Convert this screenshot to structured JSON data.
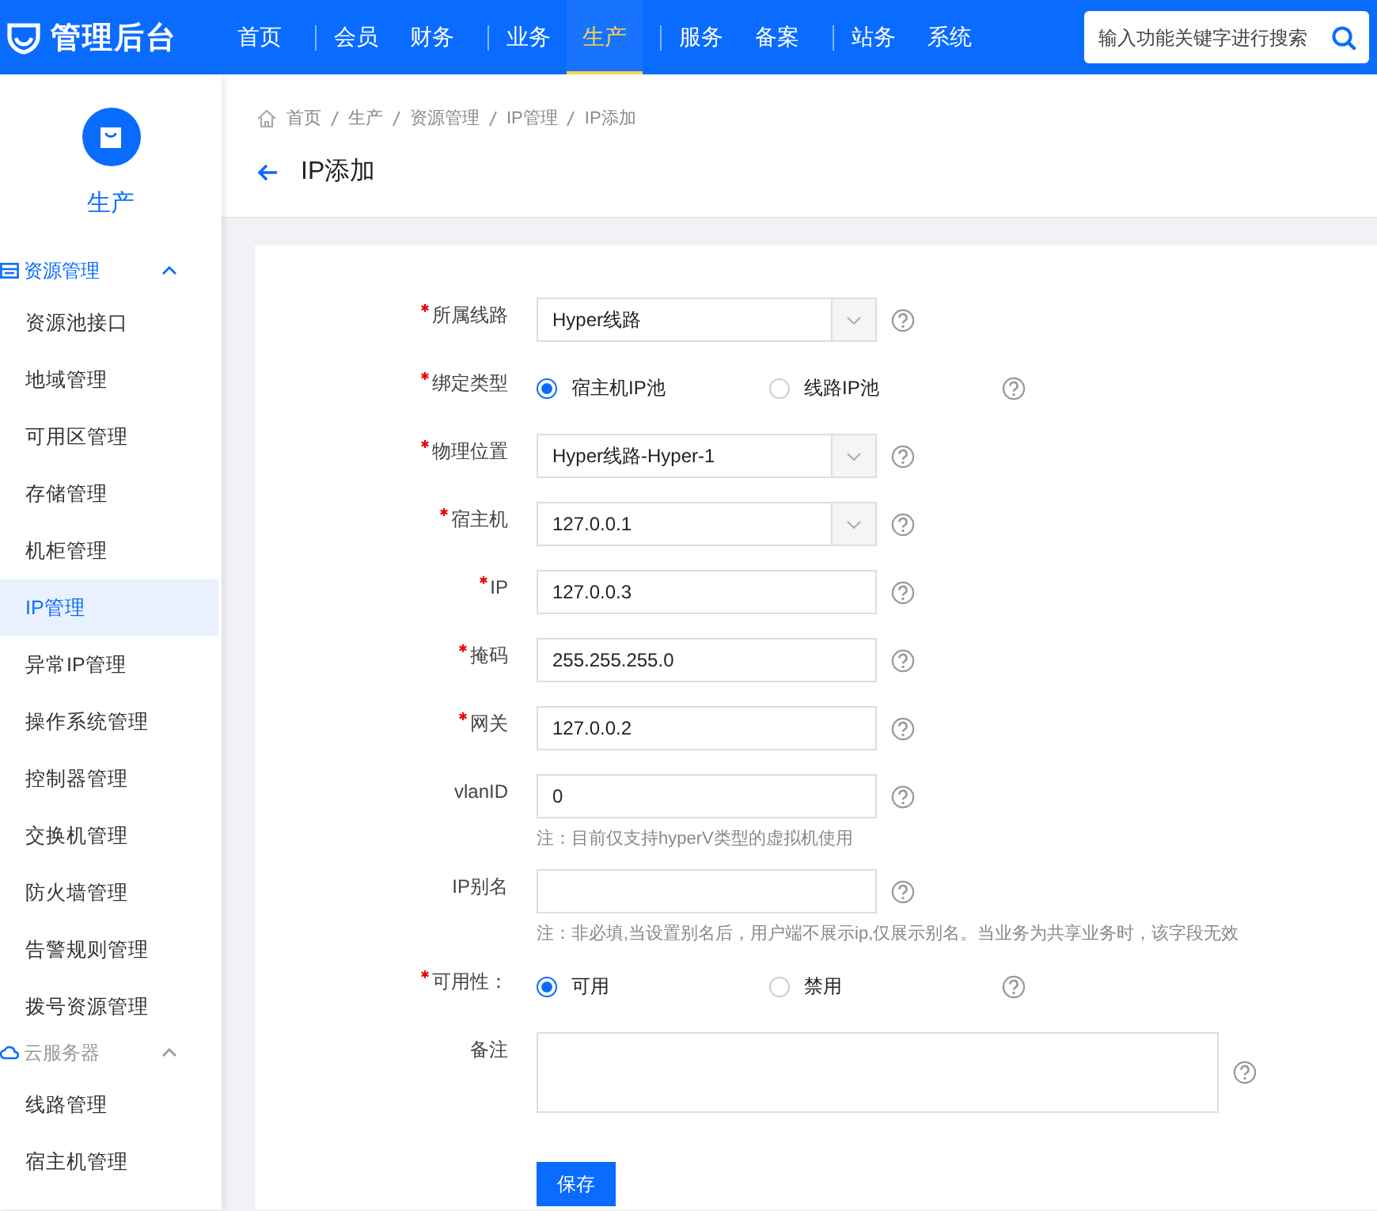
{
  "topbar": {
    "logo": "管理后台",
    "nav_groups": [
      [
        {
          "label": "首页",
          "selected": false
        }
      ],
      [
        {
          "label": "会员",
          "selected": false
        },
        {
          "label": "财务",
          "selected": false
        }
      ],
      [
        {
          "label": "业务",
          "selected": false
        },
        {
          "label": "生产",
          "selected": true
        }
      ],
      [
        {
          "label": "服务",
          "selected": false
        },
        {
          "label": "备案",
          "selected": false
        }
      ],
      [
        {
          "label": "站务",
          "selected": false
        },
        {
          "label": "系统",
          "selected": false
        }
      ]
    ],
    "search": {
      "placeholder": "输入功能关键字进行搜索"
    }
  },
  "sidebar": {
    "title": "生产",
    "groups": [
      {
        "label": "资源管理",
        "kind": "resource",
        "expanded": true,
        "items": [
          {
            "label": "资源池接口",
            "selected": false
          },
          {
            "label": "地域管理",
            "selected": false
          },
          {
            "label": "可用区管理",
            "selected": false
          },
          {
            "label": "存储管理",
            "selected": false
          },
          {
            "label": "机柜管理",
            "selected": false
          },
          {
            "label": "IP管理",
            "selected": true
          },
          {
            "label": "异常IP管理",
            "selected": false
          },
          {
            "label": "操作系统管理",
            "selected": false
          },
          {
            "label": "控制器管理",
            "selected": false
          },
          {
            "label": "交换机管理",
            "selected": false
          },
          {
            "label": "防火墙管理",
            "selected": false
          },
          {
            "label": "告警规则管理",
            "selected": false
          },
          {
            "label": "拨号资源管理",
            "selected": false
          }
        ]
      },
      {
        "label": "云服务器",
        "kind": "cloud",
        "expanded": true,
        "items": [
          {
            "label": "线路管理",
            "selected": false
          },
          {
            "label": "宿主机管理",
            "selected": false
          }
        ]
      }
    ]
  },
  "breadcrumb": [
    "首页",
    "生产",
    "资源管理",
    "IP管理",
    "IP添加"
  ],
  "page_title": "IP添加",
  "form": {
    "fields": [
      {
        "label": "所属线路",
        "required": true,
        "kind": "select",
        "value": "Hyper线路"
      },
      {
        "label": "绑定类型",
        "required": true,
        "kind": "radio",
        "options": [
          {
            "label": "宿主机IP池",
            "selected": true
          },
          {
            "label": "线路IP池",
            "selected": false
          }
        ]
      },
      {
        "label": "物理位置",
        "required": true,
        "kind": "select",
        "value": "Hyper线路-Hyper-1"
      },
      {
        "label": "宿主机",
        "required": true,
        "kind": "select",
        "value": "127.0.0.1"
      },
      {
        "label": "IP",
        "required": true,
        "kind": "input",
        "value": "127.0.0.3"
      },
      {
        "label": "掩码",
        "required": true,
        "kind": "input",
        "value": "255.255.255.0"
      },
      {
        "label": "网关",
        "required": true,
        "kind": "input",
        "value": "127.0.0.2"
      },
      {
        "label": "vlanID",
        "required": false,
        "kind": "input",
        "value": "0",
        "note": "注：目前仅支持hyperV类型的虚拟机使用"
      },
      {
        "label": "IP别名",
        "required": false,
        "kind": "input",
        "note": "注：非必填,当设置别名后，用户端不展示ip,仅展示别名。当业务为共享业务时，该字段无效"
      },
      {
        "label": "可用性：",
        "required": true,
        "kind": "radio",
        "options": [
          {
            "label": "可用",
            "selected": true
          },
          {
            "label": "禁用",
            "selected": false
          }
        ]
      },
      {
        "label": "备注",
        "required": false,
        "kind": "textarea"
      }
    ],
    "submit": "保存"
  }
}
